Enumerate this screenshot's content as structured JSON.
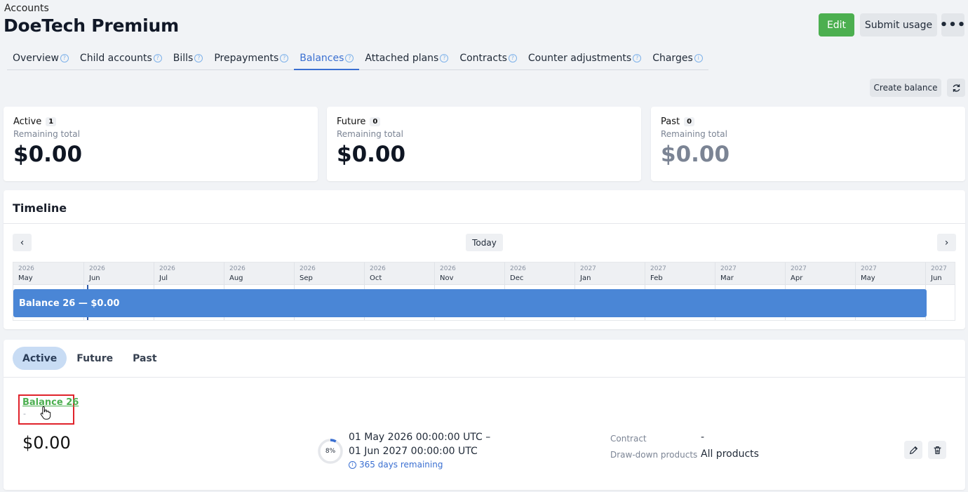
{
  "breadcrumb": "Accounts",
  "title": "DoeTech Premium",
  "actions": {
    "edit": "Edit",
    "submit_usage": "Submit usage",
    "more": "•••"
  },
  "tabs": [
    {
      "label": "Overview",
      "icon": "question-icon"
    },
    {
      "label": "Child accounts",
      "icon": "question-icon"
    },
    {
      "label": "Bills",
      "icon": "question-icon"
    },
    {
      "label": "Prepayments",
      "icon": "question-icon"
    },
    {
      "label": "Balances",
      "icon": "question-icon",
      "active": true
    },
    {
      "label": "Attached plans",
      "icon": "question-icon"
    },
    {
      "label": "Contracts",
      "icon": "question-icon"
    },
    {
      "label": "Counter adjustments",
      "icon": "question-icon"
    },
    {
      "label": "Charges",
      "icon": "info-icon"
    }
  ],
  "toolbar": {
    "create_balance": "Create balance",
    "refresh_icon": "refresh-icon"
  },
  "stats": [
    {
      "label": "Active",
      "count": "1",
      "sub": "Remaining total",
      "value": "$0.00"
    },
    {
      "label": "Future",
      "count": "0",
      "sub": "Remaining total",
      "value": "$0.00"
    },
    {
      "label": "Past",
      "count": "0",
      "sub": "Remaining total",
      "value": "$0.00"
    }
  ],
  "timeline": {
    "title": "Timeline",
    "today": "Today",
    "columns": [
      {
        "year": "2026",
        "month": "May"
      },
      {
        "year": "2026",
        "month": "Jun"
      },
      {
        "year": "2026",
        "month": "Jul"
      },
      {
        "year": "2026",
        "month": "Aug"
      },
      {
        "year": "2026",
        "month": "Sep"
      },
      {
        "year": "2026",
        "month": "Oct"
      },
      {
        "year": "2026",
        "month": "Nov"
      },
      {
        "year": "2026",
        "month": "Dec"
      },
      {
        "year": "2027",
        "month": "Jan"
      },
      {
        "year": "2027",
        "month": "Feb"
      },
      {
        "year": "2027",
        "month": "Mar"
      },
      {
        "year": "2027",
        "month": "Apr"
      },
      {
        "year": "2027",
        "month": "May"
      },
      {
        "year": "2027",
        "month": "Jun"
      }
    ],
    "bar_label": "Balance 26 — $0.00"
  },
  "filter": {
    "active": "Active",
    "future": "Future",
    "past": "Past"
  },
  "balance": {
    "name": "Balance 26",
    "description": "-",
    "amount": "$0.00",
    "progress_percent": 8,
    "progress_label": "8%",
    "date_from": "01 May 2026 00:00:00 UTC –",
    "date_to": "01 Jun 2027 00:00:00 UTC",
    "remaining": "365 days remaining",
    "contract_label": "Contract",
    "contract_value": "-",
    "products_label": "Draw-down products",
    "products_value": "All products"
  },
  "colors": {
    "accent": "#3a6fd1",
    "edit_green": "#4caf50",
    "bar_blue": "#4a86d6"
  }
}
